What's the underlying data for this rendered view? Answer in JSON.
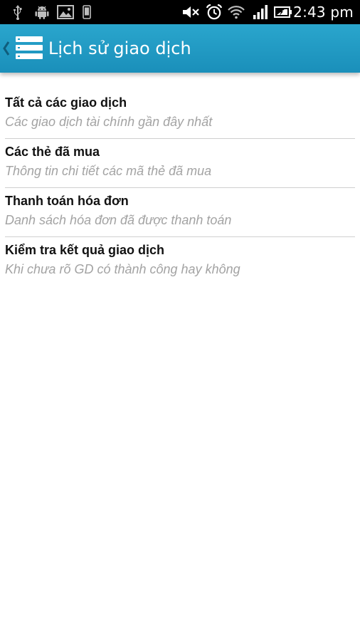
{
  "status_bar": {
    "time": "2:43 pm",
    "icons": [
      "usb-icon",
      "android-debug-icon",
      "image-icon",
      "phone-icon",
      "mute-icon",
      "alarm-icon",
      "wifi-icon",
      "signal-icon",
      "battery-icon"
    ]
  },
  "action_bar": {
    "title": "Lịch sử giao dịch",
    "color": "#1f9cc6"
  },
  "list": {
    "items": [
      {
        "title": "Tất cả các giao dịch",
        "subtitle": "Các giao dịch tài chính gần đây nhất"
      },
      {
        "title": "Các thẻ đã mua",
        "subtitle": "Thông tin chi tiết các mã thẻ đã mua"
      },
      {
        "title": "Thanh toán hóa đơn",
        "subtitle": "Danh sách hóa đơn đã được thanh toán"
      },
      {
        "title": "Kiểm tra kết quả giao dịch",
        "subtitle": "Khi chưa rõ GD có thành công hay không"
      }
    ]
  }
}
